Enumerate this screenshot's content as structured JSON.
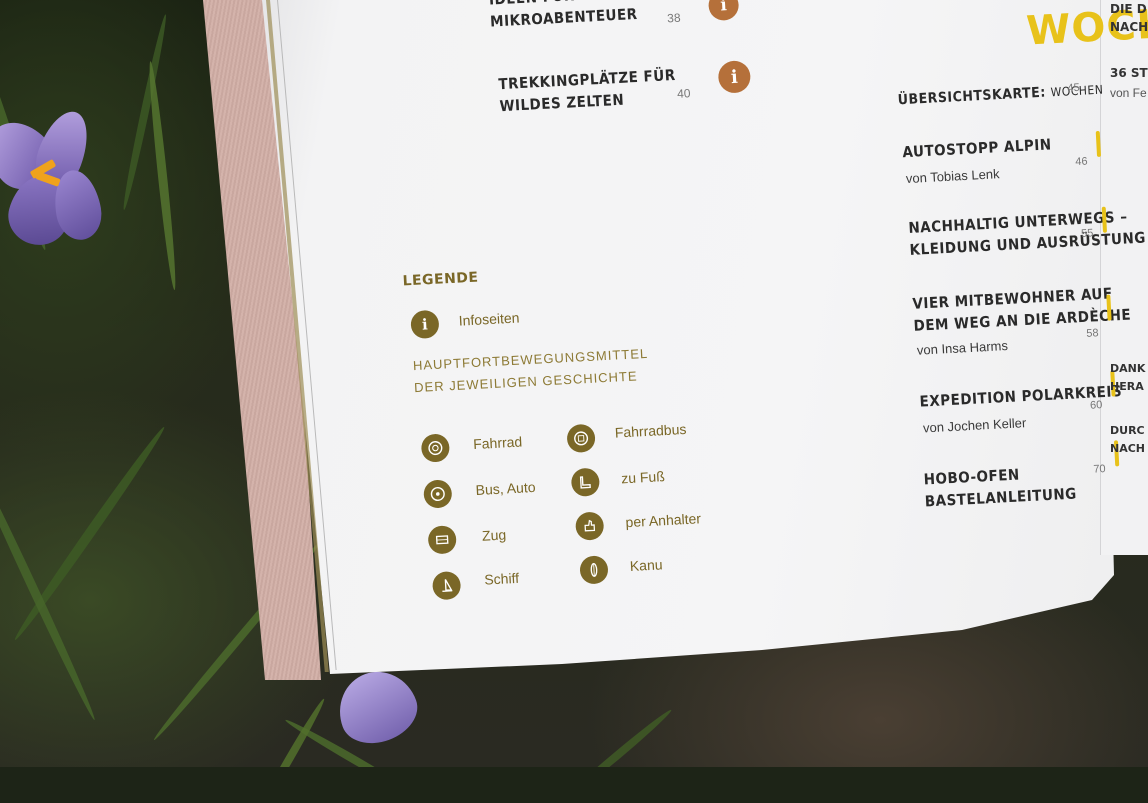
{
  "toc_left": [
    {
      "title_lines": [
        "IDEEN FÜR",
        "MIKROABENTEUER"
      ],
      "page": "38",
      "info": true
    },
    {
      "title_lines": [
        "TREKKINGPLÄTZE FÜR",
        "WILDES ZELTEN"
      ],
      "page": "40",
      "info": true
    }
  ],
  "section_heading": "WOCHE",
  "toc_right": [
    {
      "title": "ÜBERSICHTSKARTE:",
      "title_suffix": "WOCHEN",
      "page": "45"
    },
    {
      "title_lines": [
        "AUTOSTOPP ALPIN"
      ],
      "author": "von Tobias Lenk",
      "page": "46"
    },
    {
      "title_lines": [
        "NACHHALTIG UNTERWEGS –",
        "KLEIDUNG UND AUSRÜSTUNG"
      ],
      "page": "55"
    },
    {
      "title_lines": [
        "VIER MITBEWOHNER AUF",
        "DEM WEG AN DIE ARDÈCHE"
      ],
      "author": "von Insa Harms",
      "page": "58"
    },
    {
      "title_lines": [
        "EXPEDITION POLARKREIS"
      ],
      "author": "von Jochen Keller",
      "page": "60"
    },
    {
      "title_lines": [
        "HOBO-OFEN",
        "BASTELANLEITUNG"
      ],
      "page": "70"
    }
  ],
  "far_right": {
    "top_lines": [
      "DIE D",
      "NACHH"
    ],
    "mid_lines": [
      "36 ST",
      "von Fe"
    ],
    "lower1": [
      "DANK",
      "HERA"
    ],
    "lower2": [
      "DURC",
      "NACH"
    ]
  },
  "legend": {
    "title": "LEGENDE",
    "info_label": "Infoseiten",
    "subtitle_lines": [
      "HAUPTFORTBEWEGUNGSMITTEL",
      "DER JEWEILIGEN GESCHICHTE"
    ],
    "items": [
      {
        "label": "Fahrrad",
        "icon": "bicycle-icon"
      },
      {
        "label": "Fahrradbus",
        "icon": "bicycle-bus-icon"
      },
      {
        "label": "Bus, Auto",
        "icon": "car-icon"
      },
      {
        "label": "zu Fuß",
        "icon": "boot-icon"
      },
      {
        "label": "Zug",
        "icon": "train-icon"
      },
      {
        "label": "per Anhalter",
        "icon": "thumb-icon"
      },
      {
        "label": "Schiff",
        "icon": "sailboat-icon"
      },
      {
        "label": "Kanu",
        "icon": "canoe-icon"
      }
    ]
  },
  "colors": {
    "legend_olive": "#7a6727",
    "info_orange": "#b5703a",
    "accent_yellow": "#e8c21a",
    "cover_pink": "#d4b3ab"
  }
}
